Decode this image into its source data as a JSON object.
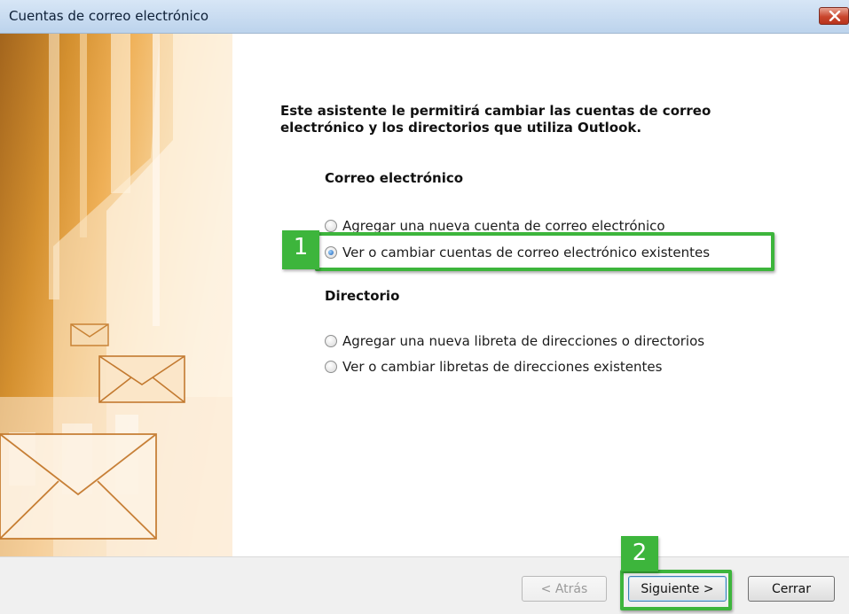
{
  "window": {
    "title": "Cuentas de correo electrónico"
  },
  "main": {
    "intro": "Este asistente le permitirá cambiar las cuentas de correo electrónico y los directorios que utiliza Outlook.",
    "email_section": {
      "title": "Correo electrónico",
      "options": [
        {
          "label": "Agregar una nueva cuenta de correo electrónico",
          "checked": false
        },
        {
          "label": "Ver o cambiar cuentas de correo electrónico existentes",
          "checked": true
        }
      ]
    },
    "directory_section": {
      "title": "Directorio",
      "options": [
        {
          "label": "Agregar una nueva libreta de direcciones o directorios",
          "checked": false
        },
        {
          "label": "Ver o cambiar libretas de direcciones existentes",
          "checked": false
        }
      ]
    }
  },
  "annotations": {
    "step1": "1",
    "step2": "2",
    "color": "#3db53c"
  },
  "footer": {
    "back_label": "< Atrás",
    "next_label": "Siguiente >",
    "close_label": "Cerrar"
  },
  "icons": {
    "close": "close-icon",
    "banner": "envelope-icon"
  }
}
